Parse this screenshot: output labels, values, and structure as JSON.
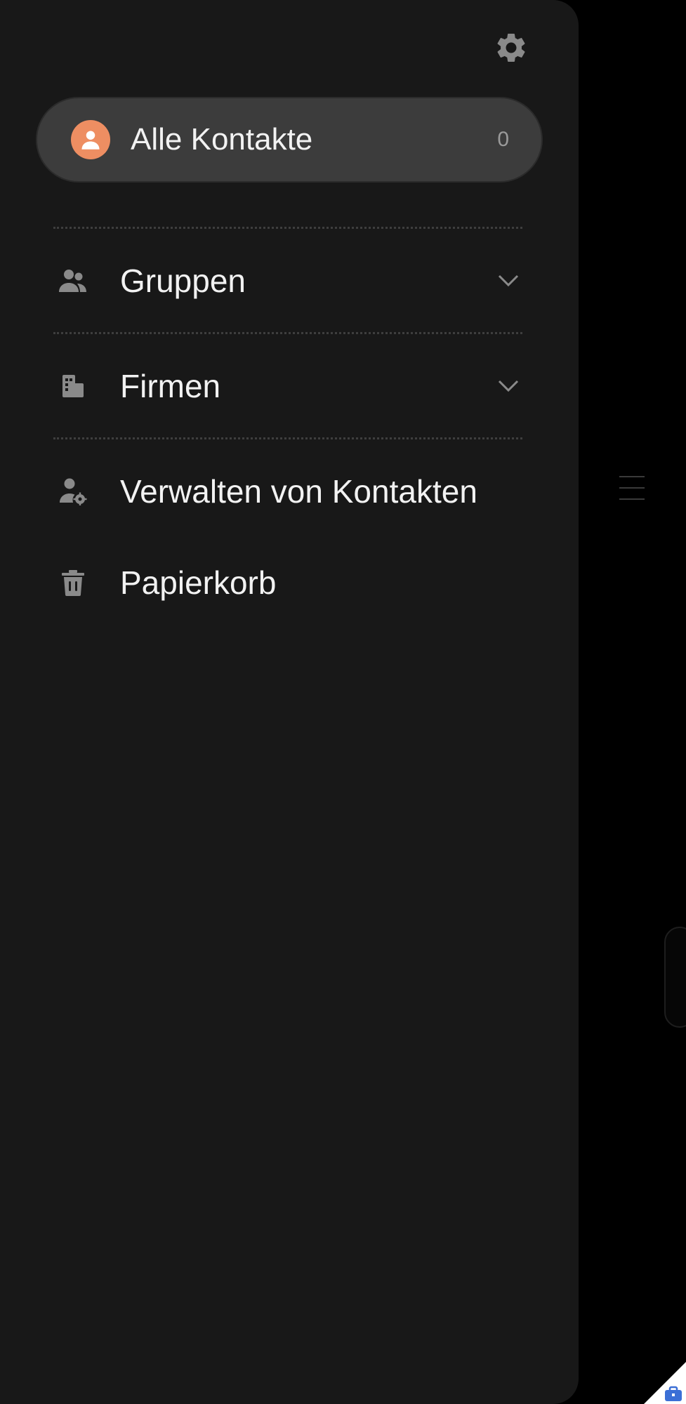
{
  "drawer": {
    "all_contacts": {
      "label": "Alle Kontakte",
      "count": "0",
      "avatar_color": "#ee8e62"
    },
    "items": [
      {
        "label": "Gruppen",
        "icon": "groups-icon",
        "expandable": true
      },
      {
        "label": "Firmen",
        "icon": "building-icon",
        "expandable": true
      },
      {
        "label": "Verwalten von Kontakten",
        "icon": "manage-contacts-icon",
        "expandable": false
      },
      {
        "label": "Papierkorb",
        "icon": "trash-icon",
        "expandable": false
      }
    ],
    "settings_icon": "gear-icon"
  },
  "colors": {
    "drawer_bg": "#181818",
    "pill_bg": "#3c3c3c",
    "text": "#f2f2f2",
    "icon": "#8a8a8a",
    "accent": "#ee8e62"
  }
}
